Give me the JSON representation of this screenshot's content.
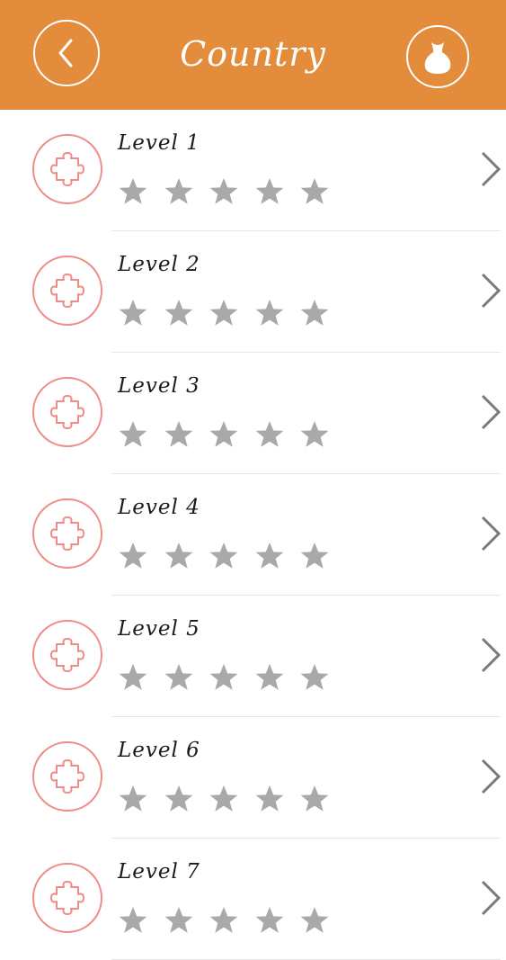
{
  "header": {
    "title": "Country",
    "back_icon": "back-chevron-icon",
    "bag_icon": "money-bag-icon",
    "color": "#e38c3c"
  },
  "levels": [
    {
      "label": "Level 1",
      "stars_earned": 0,
      "stars_total": 5
    },
    {
      "label": "Level 2",
      "stars_earned": 0,
      "stars_total": 5
    },
    {
      "label": "Level 3",
      "stars_earned": 0,
      "stars_total": 5
    },
    {
      "label": "Level 4",
      "stars_earned": 0,
      "stars_total": 5
    },
    {
      "label": "Level 5",
      "stars_earned": 0,
      "stars_total": 5
    },
    {
      "label": "Level 6",
      "stars_earned": 0,
      "stars_total": 5
    },
    {
      "label": "Level 7",
      "stars_earned": 0,
      "stars_total": 5
    }
  ],
  "colors": {
    "star_empty": "#a9a9ab",
    "puzzle_outline": "#f08c88",
    "chevron": "#7a7a7a"
  }
}
